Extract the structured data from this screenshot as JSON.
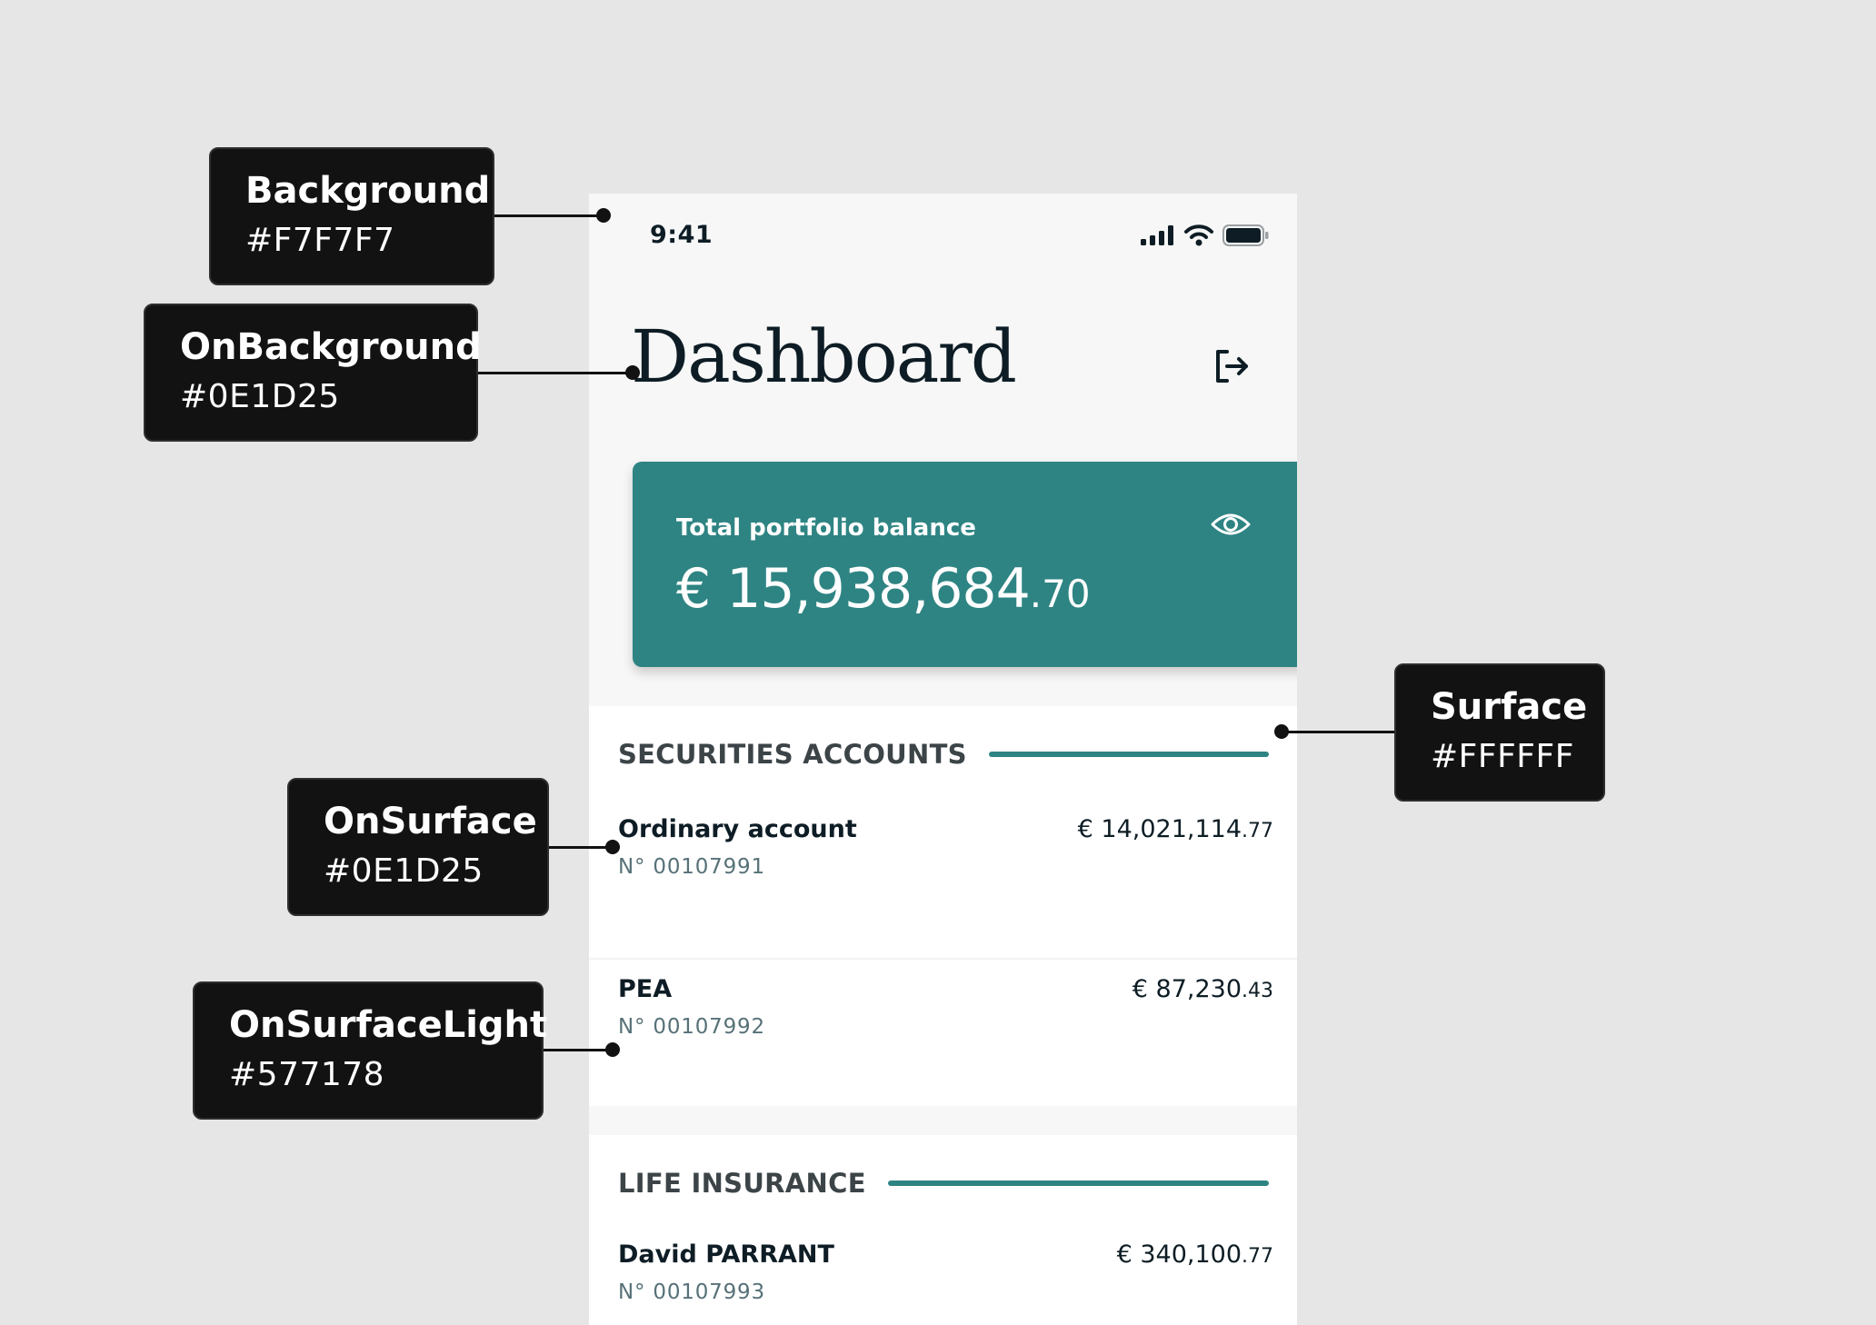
{
  "status_bar": {
    "time": "9:41",
    "icons": [
      "signal-icon",
      "wifi-icon",
      "battery-icon"
    ]
  },
  "header": {
    "title": "Dashboard",
    "logout_icon": "logout-icon"
  },
  "balance": {
    "label": "Total portfolio balance",
    "amount_main": "€ 15,938,684",
    "amount_cents": ".70",
    "visibility_icon": "eye-icon"
  },
  "sections": [
    {
      "title": "SECURITIES ACCOUNTS",
      "accounts": [
        {
          "name": "Ordinary account",
          "number": "N° 00107991",
          "amount_main": "€ 14,021,114",
          "amount_cents": ".77"
        },
        {
          "name": "PEA",
          "number": "N° 00107992",
          "amount_main": "€ 87,230",
          "amount_cents": ".43"
        }
      ]
    },
    {
      "title": "LIFE INSURANCE",
      "accounts": [
        {
          "name": "David PARRANT",
          "number": "N° 00107993",
          "amount_main": "€ 340,100",
          "amount_cents": ".77"
        }
      ]
    }
  ],
  "annotations": [
    {
      "name": "Background",
      "hex": "#F7F7F7"
    },
    {
      "name": "OnBackground",
      "hex": "#0E1D25"
    },
    {
      "name": "Surface",
      "hex": "#FFFFFF"
    },
    {
      "name": "OnSurface",
      "hex": "#0E1D25"
    },
    {
      "name": "OnSurfaceLight",
      "hex": "#577178"
    }
  ],
  "colors": {
    "canvas": "#E6E6E6",
    "background": "#F7F7F7",
    "on_background": "#0E1D25",
    "surface": "#FFFFFF",
    "on_surface": "#0E1D25",
    "on_surface_light": "#577178",
    "accent": "#2E8483",
    "tag_background": "#121212"
  }
}
